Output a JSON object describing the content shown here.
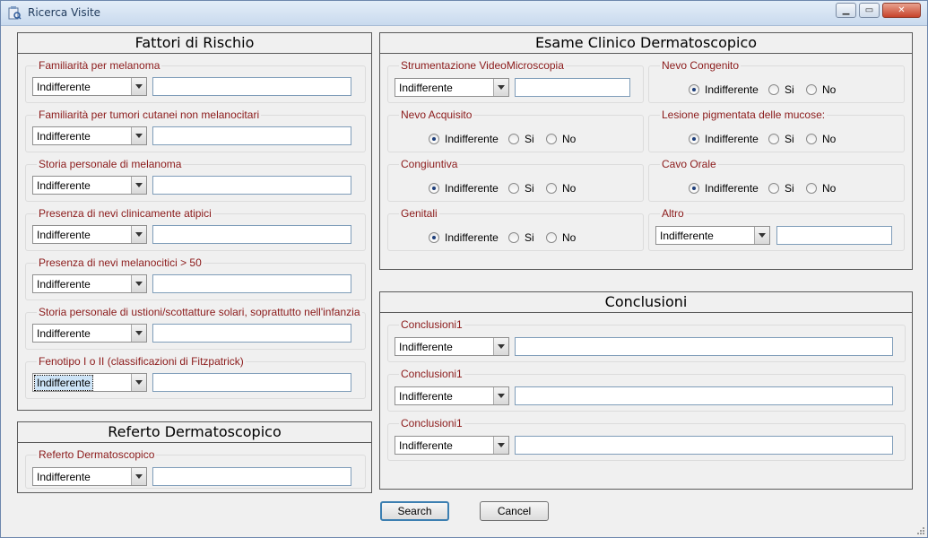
{
  "window": {
    "title": "Ricerca Visite"
  },
  "combo_default": "Indifferente",
  "fattori": {
    "title": "Fattori di Rischio",
    "groups": [
      {
        "label": "Familiarità per melanoma",
        "value": "Indifferente",
        "text": ""
      },
      {
        "label": "Familiarità per tumori cutanei non melanocitari",
        "value": "Indifferente",
        "text": ""
      },
      {
        "label": "Storia personale di melanoma",
        "value": "Indifferente",
        "text": ""
      },
      {
        "label": "Presenza di nevi clinicamente atipici",
        "value": "Indifferente",
        "text": ""
      },
      {
        "label": "Presenza di nevi melanocitici > 50",
        "value": "Indifferente",
        "text": ""
      },
      {
        "label": "Storia personale di ustioni/scottatture solari, soprattutto nell'infanzia",
        "value": "Indifferente",
        "text": ""
      },
      {
        "label": "Fenotipo I o II (classificazioni di Fitzpatrick)",
        "value": "Indifferente",
        "text": ""
      }
    ]
  },
  "referto": {
    "title": "Referto Dermatoscopico",
    "label": "Referto Dermatoscopico",
    "value": "Indifferente"
  },
  "esame": {
    "title": "Esame Clinico Dermatoscopico",
    "strumentazione": {
      "label": "Strumentazione VideoMicroscopia",
      "value": "Indifferente"
    },
    "nevo_congenito": {
      "label": "Nevo Congenito"
    },
    "nevo_acquisito": {
      "label": "Nevo Acquisito"
    },
    "lesione": {
      "label": "Lesione pigmentata delle mucose:"
    },
    "congiuntiva": {
      "label": "Congiuntiva"
    },
    "cavo_orale": {
      "label": "Cavo Orale"
    },
    "genitali": {
      "label": "Genitali"
    },
    "altro": {
      "label": "Altro",
      "value": "Indifferente"
    },
    "radio_options": [
      "Indifferente",
      "Si",
      "No"
    ],
    "selected_option": "Indifferente"
  },
  "conclusioni": {
    "title": "Conclusioni",
    "groups": [
      {
        "label": "Conclusioni1",
        "value": "Indifferente"
      },
      {
        "label": "Conclusioni1",
        "value": "Indifferente"
      },
      {
        "label": "Conclusioni1",
        "value": "Indifferente"
      }
    ]
  },
  "buttons": {
    "search": "Search",
    "cancel": "Cancel"
  },
  "colors": {
    "group_label": "#8b1a1a",
    "title_bar": "#c9daee",
    "close_button": "#c7432b"
  },
  "icons": [
    "app-icon",
    "minimize-icon",
    "maximize-icon",
    "close-icon",
    "dropdown-arrow-icon",
    "resize-grip-icon"
  ]
}
